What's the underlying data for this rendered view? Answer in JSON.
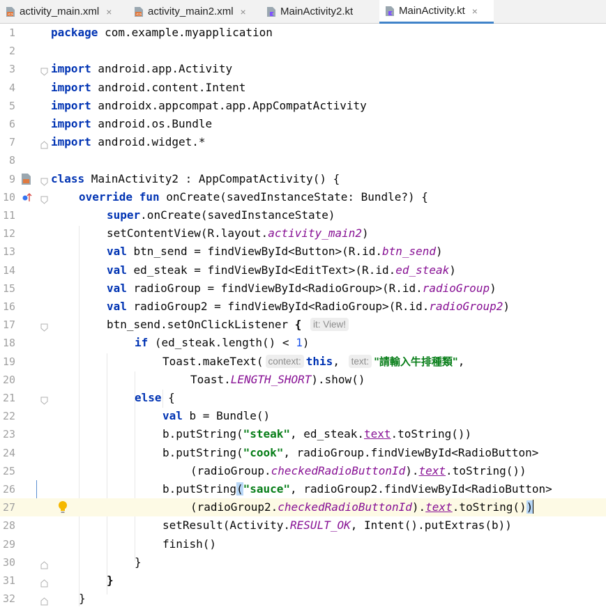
{
  "tabs": [
    {
      "label": "activity_main.xml",
      "icon": "xml-file-icon",
      "close": "×",
      "active": false
    },
    {
      "label": "activity_main2.xml",
      "icon": "xml-file-icon",
      "close": "×",
      "active": false
    },
    {
      "label": "MainActivity2.kt",
      "icon": "kotlin-file-icon",
      "close": "",
      "active": false
    },
    {
      "label": "MainActivity.kt",
      "icon": "kotlin-file-icon",
      "close": "×",
      "active": true
    }
  ],
  "line_numbers": [
    "1",
    "2",
    "3",
    "4",
    "5",
    "6",
    "7",
    "8",
    "9",
    "10",
    "11",
    "12",
    "13",
    "14",
    "15",
    "16",
    "17",
    "18",
    "19",
    "20",
    "21",
    "22",
    "23",
    "24",
    "25",
    "26",
    "27",
    "28",
    "29",
    "30",
    "31",
    "32"
  ],
  "colors": {
    "keyword": "#0033b3",
    "string": "#067d17",
    "number": "#1750eb",
    "property": "#871094",
    "tab_underline": "#4083c9",
    "caret_line": "#fdfae5"
  },
  "code": {
    "l1": [
      "package",
      " com.example.myapplication"
    ],
    "l3": [
      "import",
      " android.app.Activity"
    ],
    "l4": [
      "import",
      " android.content.Intent"
    ],
    "l5": [
      "import",
      " androidx.appcompat.app.AppCompatActivity"
    ],
    "l6": [
      "import",
      " android.os.Bundle"
    ],
    "l7": [
      "import",
      " android.widget.*"
    ],
    "l9": [
      "class",
      " MainActivity2 : AppCompatActivity() {"
    ],
    "l10": [
      "override",
      " ",
      "fun",
      " onCreate(savedInstanceState: Bundle?) {"
    ],
    "l11": [
      "super",
      ".onCreate(savedInstanceState)"
    ],
    "l12": [
      "setContentView(R.layout.",
      "activity_main2",
      ")"
    ],
    "l13": [
      "val",
      " btn_send = findViewById<Button>(R.id.",
      "btn_send",
      ")"
    ],
    "l14": [
      "val",
      " ed_steak = findViewById<EditText>(R.id.",
      "ed_steak",
      ")"
    ],
    "l15": [
      "val",
      " radioGroup = findViewById<RadioGroup>(R.id.",
      "radioGroup",
      ")"
    ],
    "l16": [
      "val",
      " radioGroup2 = findViewById<RadioGroup>(R.id.",
      "radioGroup2",
      ")"
    ],
    "l17": [
      "btn_send.setOnClickListener ",
      "{",
      "it: View!"
    ],
    "l18": [
      "if",
      " (ed_steak.length() < ",
      "1",
      ")"
    ],
    "l19": [
      "Toast.makeText(",
      "context:",
      "this",
      ",",
      "text:",
      "\"請輸入牛排種類\"",
      ","
    ],
    "l20": [
      "Toast.",
      "LENGTH_SHORT",
      ").show()"
    ],
    "l21": [
      "else",
      " {"
    ],
    "l22": [
      "val",
      " b = Bundle()"
    ],
    "l23": [
      "b.putString(",
      "\"steak\"",
      ", ed_steak.",
      "text",
      ".toString())"
    ],
    "l24": [
      "b.putString(",
      "\"cook\"",
      ", radioGroup.findViewById<RadioButton>"
    ],
    "l25": [
      "(radioGroup.",
      "checkedRadioButtonId",
      ").",
      "text",
      ".toString())"
    ],
    "l26": [
      "b.putString",
      "(",
      "\"sauce\"",
      ", radioGroup2.findViewById<RadioButton>"
    ],
    "l27": [
      "(radioGroup2.",
      "checkedRadioButtonId",
      ").",
      "text",
      ".toString()",
      ")"
    ],
    "l28": [
      "setResult(Activity.",
      "RESULT_OK",
      ", Intent().putExtras(b))"
    ],
    "l29": [
      "finish()"
    ],
    "l30": [
      "}"
    ],
    "l31": [
      "}"
    ],
    "l32": [
      "}"
    ]
  }
}
